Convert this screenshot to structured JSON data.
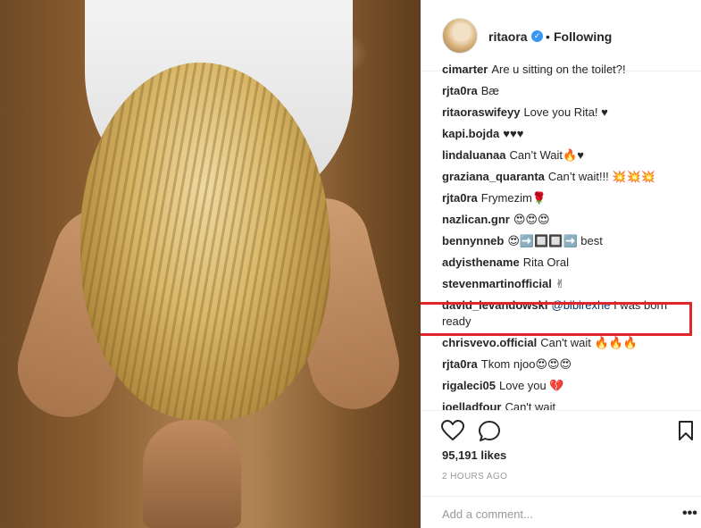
{
  "post": {
    "username": "ritaora",
    "separator": "•",
    "follow_status": "Following",
    "likes": "95,191 likes",
    "time": "2 HOURS AGO",
    "add_comment_placeholder": "Add a comment...",
    "more_label": "•••"
  },
  "comments": [
    {
      "user": "cimarter",
      "text": "Are u sitting on the toilet?!"
    },
    {
      "user": "rjta0ra",
      "text": "Bæ"
    },
    {
      "user": "ritaoraswifeyy",
      "text": "Love you Rita! ♥"
    },
    {
      "user": "kapi.bojda",
      "text": "♥♥♥"
    },
    {
      "user": "lindaluanaa",
      "text": "Can’t Wait🔥♥"
    },
    {
      "user": "graziana_quaranta",
      "text": "Can’t wait!!! 💥💥💥"
    },
    {
      "user": "rjta0ra",
      "text": "Frymezim🌹"
    },
    {
      "user": "nazlican.gnr",
      "text": "😍😍😍"
    },
    {
      "user": "bennynneb",
      "text": "😍➡️🔲🔲➡️ best"
    },
    {
      "user": "adyisthename",
      "text": "Rita Oral"
    },
    {
      "user": "stevenmartinofficial",
      "text": "✌"
    },
    {
      "user": "david_levandowski",
      "mention": "@bibirexhe",
      "text": "I was born ready"
    },
    {
      "user": "chrisvevo.official",
      "text": "Can't wait 🔥🔥🔥"
    },
    {
      "user": "rjta0ra",
      "text": "Tkom njoo😍😍😍"
    },
    {
      "user": "rigaleci05",
      "text": "Love you 💔"
    },
    {
      "user": "joelladfour",
      "text": "Can't wait"
    }
  ],
  "icons": {
    "heart": "heart-icon",
    "comment": "comment-icon",
    "bookmark": "bookmark-icon",
    "verified": "verified-badge-icon",
    "verified_glyph": "✓"
  },
  "colors": {
    "highlight": "#e0262a",
    "verified": "#3897f0"
  }
}
